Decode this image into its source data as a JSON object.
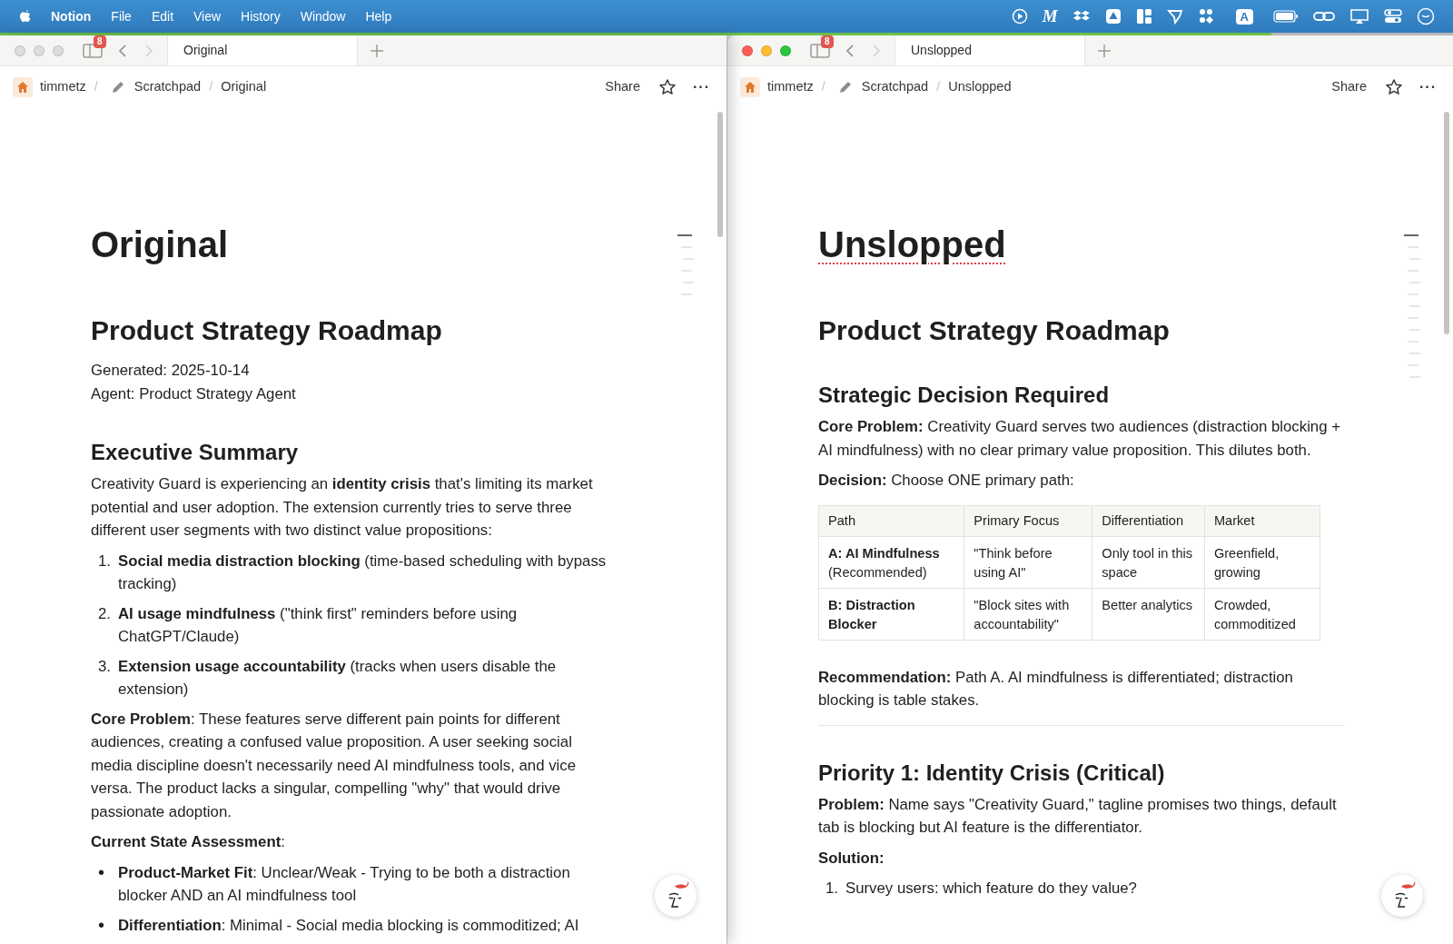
{
  "menu_bar": {
    "app": "Notion",
    "items": [
      "File",
      "Edit",
      "View",
      "History",
      "Window",
      "Help"
    ],
    "status_letters": [
      "M",
      "A"
    ]
  },
  "loading_bar": {
    "level": 0.875
  },
  "windows": [
    {
      "focused": false,
      "sidebar_badge": "8",
      "tab": {
        "title": "Original"
      },
      "breadcrumb": [
        "timmetz",
        "Scratchpad",
        "Original"
      ],
      "breadcrumb_separators": [
        "/",
        "/"
      ],
      "share": "Share",
      "overflow": "···",
      "page": {
        "title": "Original",
        "title_misspelled": false,
        "blocks": [
          {
            "kind": "h1",
            "text": "Product Strategy Roadmap"
          },
          {
            "kind": "line",
            "text": "Generated: 2025-10-14"
          },
          {
            "kind": "line",
            "text": "Agent: Product Strategy Agent"
          },
          {
            "kind": "h2",
            "text": "Executive Summary"
          },
          {
            "kind": "p",
            "text": "Creativity Guard is experiencing an **identity crisis** that's limiting its market potential and user adoption. The extension currently tries to serve three different user segments with two distinct value propositions:"
          },
          {
            "kind": "ol",
            "items": [
              {
                "marker": "1.",
                "text": "**Social media distraction blocking** (time-based scheduling with bypass tracking)"
              },
              {
                "marker": "2.",
                "text": "**AI usage mindfulness** (\"think first\" reminders before using ChatGPT/Claude)"
              },
              {
                "marker": "3.",
                "text": "**Extension usage accountability** (tracks when users disable the extension)"
              }
            ]
          },
          {
            "kind": "p",
            "text": "**Core Problem**: These features serve different pain points for different audiences, creating a confused value proposition. A user seeking social media discipline doesn't necessarily need AI mindfulness tools, and vice versa. The product lacks a singular, compelling \"why\" that would drive passionate adoption."
          },
          {
            "kind": "p",
            "text": "**Current State Assessment**:"
          },
          {
            "kind": "ul",
            "items": [
              {
                "marker": "•",
                "text": "**Product-Market Fit**: Unclear/Weak - Trying to be both a distraction blocker AND an AI mindfulness tool"
              },
              {
                "marker": "•",
                "text": "**Differentiation**: Minimal - Social media blocking is commoditized; AI"
              }
            ]
          }
        ]
      }
    },
    {
      "focused": true,
      "sidebar_badge": "8",
      "tab": {
        "title": "Unslopped"
      },
      "breadcrumb": [
        "timmetz",
        "Scratchpad",
        "Unslopped"
      ],
      "breadcrumb_separators": [
        "/",
        "/"
      ],
      "share": "Share",
      "overflow": "···",
      "page": {
        "title": "Unslopped",
        "title_misspelled": true,
        "blocks": [
          {
            "kind": "h1",
            "text": "Product Strategy Roadmap"
          },
          {
            "kind": "h2",
            "text": "Strategic Decision Required"
          },
          {
            "kind": "p",
            "text": "**Core Problem:** Creativity Guard serves two audiences (distraction blocking + AI mindfulness) with no clear primary value proposition. This dilutes both."
          },
          {
            "kind": "p",
            "text": "**Decision:** Choose ONE primary path:"
          },
          {
            "kind": "table",
            "columns": [
              "Path",
              "Primary Focus",
              "Differentiation",
              "Market"
            ],
            "rows": [
              [
                "**A: AI Mindfulness** (Recommended)",
                "\"Think before using AI\"",
                "Only tool in this space",
                "Greenfield, growing"
              ],
              [
                "**B: Distraction Blocker**",
                "\"Block sites with accountability\"",
                "Better analytics",
                "Crowded, commoditized"
              ]
            ]
          },
          {
            "kind": "p",
            "text": "**Recommendation:** Path A. AI mindfulness is differentiated; distraction blocking is table stakes."
          },
          {
            "kind": "divider"
          },
          {
            "kind": "h2",
            "text": "Priority 1: Identity Crisis (Critical)"
          },
          {
            "kind": "p",
            "text": "**Problem:** Name says \"Creativity Guard,\" tagline promises two things, default tab is blocking but AI feature is the differentiator."
          },
          {
            "kind": "p",
            "text": "**Solution:**"
          },
          {
            "kind": "ol",
            "items": [
              {
                "marker": "1.",
                "text": "Survey users: which feature do they value?"
              }
            ]
          }
        ]
      }
    }
  ]
}
